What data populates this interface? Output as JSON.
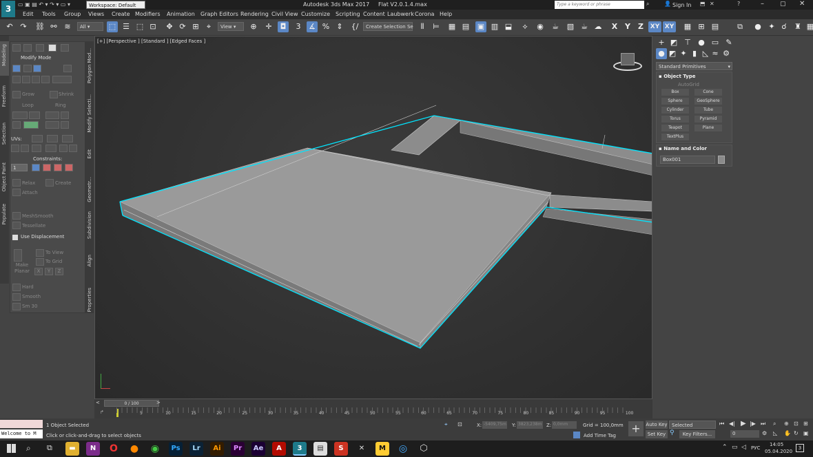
{
  "titlebar": {
    "workspace": "Workspace: Default",
    "app_title": "Autodesk 3ds Max 2017",
    "file_title": "Flat V2.0.1.4.max",
    "search_placeholder": "Type a keyword or phrase",
    "sign_in": "Sign In"
  },
  "menu": [
    "Edit",
    "Tools",
    "Group",
    "Views",
    "Create",
    "Modifiers",
    "Animation",
    "Graph Editors",
    "Rendering",
    "Civil View",
    "Customize",
    "Scripting",
    "Content",
    "Laubwerk",
    "Corona",
    "Help"
  ],
  "toolbar": {
    "filter": "All",
    "ref_coord": "View",
    "selection_set": "Create Selection Se",
    "axes": [
      "X",
      "Y",
      "Z",
      "XY",
      "XY"
    ]
  },
  "ribbon": {
    "tabs": [
      "Modeling",
      "Freeform",
      "Selection",
      "Object Paint",
      "Populate"
    ],
    "side_tabs": [
      "Polygon Mod...",
      "Modify Selecti...",
      "Edit",
      "Geometr...",
      "Subdivision",
      "Align",
      "Properties"
    ],
    "modify_mode": "Modify Mode",
    "grow": "Grow",
    "shrink": "Shrink",
    "loop": "Loop",
    "ring": "Ring",
    "uvs": "UVs:",
    "uv_value": "1",
    "constraints": "Constraints:",
    "relax": "Relax",
    "create": "Create",
    "attach": "Attach",
    "meshsmooth": "MeshSmooth",
    "tessellate": "Tessellate",
    "use_displacement": "Use Displacement",
    "to_view": "To View",
    "to_grid": "To Grid",
    "make_planar": "Make Planar",
    "x": "X",
    "y": "Y",
    "z": "Z",
    "hard": "Hard",
    "smooth": "Smooth",
    "sm30": "Sm 30"
  },
  "viewport": {
    "label": "[+] [Perspective ] [Standard ] [Edged Faces ]"
  },
  "command_panel": {
    "category": "Standard Primitives",
    "object_type_header": "Object Type",
    "autogrid": "AutoGrid",
    "primitives": [
      "Box",
      "Cone",
      "Sphere",
      "GeoSphere",
      "Cylinder",
      "Tube",
      "Torus",
      "Pyramid",
      "Teapot",
      "Plane",
      "TextPlus"
    ],
    "name_color_header": "Name and Color",
    "object_name": "Box001",
    "object_color": "#8a8a8a"
  },
  "timeline": {
    "frame": "0 / 100",
    "ticks": [
      "5",
      "10",
      "15",
      "20",
      "25",
      "30",
      "35",
      "40",
      "45",
      "50",
      "55",
      "60",
      "65",
      "70",
      "75",
      "80",
      "85",
      "90",
      "95",
      "100"
    ]
  },
  "status": {
    "maxscript": "Welcome to M",
    "selected": "1 Object Selected",
    "prompt": "Click or click-and-drag to select objects",
    "x_label": "X:",
    "x_value": "-5409,75m",
    "y_label": "Y:",
    "y_value": "3823,238m",
    "z_label": "Z:",
    "z_value": "0,0mm",
    "grid": "Grid = 100,0mm",
    "add_time_tag": "Add Time Tag",
    "auto_key": "Auto Key",
    "selected_drop": "Selected",
    "set_key": "Set Key",
    "key_filters": "Key Filters...",
    "frame_field": "0"
  },
  "taskbar": {
    "apps": [
      "N",
      "Ps",
      "Lr",
      "Ai",
      "Pr",
      "Ae",
      "A",
      "3",
      "S",
      "M"
    ],
    "lang": "РУС",
    "time": "14:05",
    "date": "05.04.2020",
    "notifications": "3"
  },
  "colors": {
    "accent": "#5b87c5",
    "selection_outline": "#00e5ff"
  }
}
